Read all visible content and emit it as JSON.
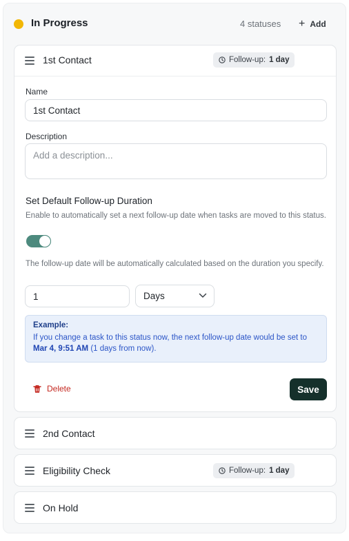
{
  "group": {
    "title": "In Progress",
    "status_count": "4 statuses",
    "add_label": "Add",
    "color": "#f2b705"
  },
  "cards": [
    {
      "title": "1st Contact",
      "badge": {
        "prefix": "Follow-up:",
        "value": "1 day"
      },
      "expanded": true
    },
    {
      "title": "2nd Contact"
    },
    {
      "title": "Eligibility Check",
      "badge": {
        "prefix": "Follow-up:",
        "value": "1 day"
      }
    },
    {
      "title": "On Hold"
    }
  ],
  "editor": {
    "name_label": "Name",
    "name_value": "1st Contact",
    "description_label": "Description",
    "description_placeholder": "Add a description...",
    "followup_title": "Set Default Follow-up Duration",
    "followup_help": "Enable to automatically set a next follow-up date when tasks are moved to this status.",
    "toggle_on": true,
    "calc_help": "The follow-up date will be automatically calculated based on the duration you specify.",
    "duration_value": "1",
    "unit_selected": "Days",
    "example": {
      "title": "Example:",
      "text_before": "If you change a task to this status now, the next follow-up date would be set to",
      "date": "Mar 4, 9:51 AM",
      "text_after": "(1 days from now)."
    },
    "delete_label": "Delete",
    "save_label": "Save"
  },
  "colors": {
    "save_bg": "#15302b",
    "toggle": "#4d8a7e",
    "delete": "#c4271f",
    "example_text": "#2b55c7"
  }
}
